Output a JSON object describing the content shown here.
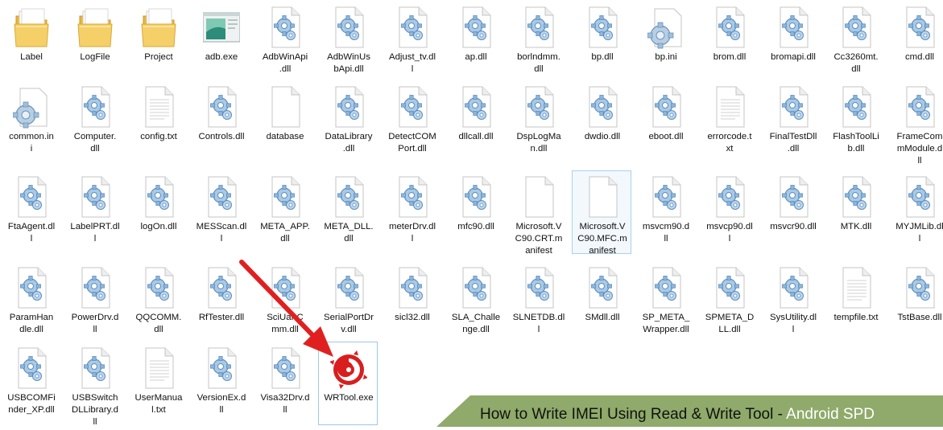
{
  "rows": [
    [
      {
        "label": "Label",
        "icon": "folder-icon"
      },
      {
        "label": "LogFile",
        "icon": "folder-icon"
      },
      {
        "label": "Project",
        "icon": "folder-icon"
      },
      {
        "label": "adb.exe",
        "icon": "application-window-icon"
      },
      {
        "label": "AdbWinApi\n.dll",
        "icon": "dll-gear-icon"
      },
      {
        "label": "AdbWinUs\nbApi.dll",
        "icon": "dll-gear-icon"
      },
      {
        "label": "Adjust_tv.dl\nl",
        "icon": "dll-gear-icon"
      },
      {
        "label": "ap.dll",
        "icon": "dll-gear-icon"
      },
      {
        "label": "borlndmm.\ndll",
        "icon": "dll-gear-icon"
      },
      {
        "label": "bp.dll",
        "icon": "dll-gear-icon"
      },
      {
        "label": "bp.ini",
        "icon": "settings-gear-icon"
      },
      {
        "label": "brom.dll",
        "icon": "dll-gear-icon"
      },
      {
        "label": "bromapi.dll",
        "icon": "dll-gear-icon"
      },
      {
        "label": "Cc3260mt.\ndll",
        "icon": "dll-gear-icon"
      },
      {
        "label": "cmd.dll",
        "icon": "dll-gear-icon"
      }
    ],
    [
      {
        "label": "common.in\ni",
        "icon": "settings-gear-icon"
      },
      {
        "label": "Computer.\ndll",
        "icon": "dll-gear-icon"
      },
      {
        "label": "config.txt",
        "icon": "text-file-icon"
      },
      {
        "label": "Controls.dll",
        "icon": "dll-gear-icon"
      },
      {
        "label": "database",
        "icon": "blank-file-icon"
      },
      {
        "label": "DataLibrary\n.dll",
        "icon": "dll-gear-icon"
      },
      {
        "label": "DetectCOM\nPort.dll",
        "icon": "dll-gear-icon"
      },
      {
        "label": "dllcall.dll",
        "icon": "dll-gear-icon"
      },
      {
        "label": "DspLogMa\nn.dll",
        "icon": "dll-gear-icon"
      },
      {
        "label": "dwdio.dll",
        "icon": "dll-gear-icon"
      },
      {
        "label": "eboot.dll",
        "icon": "dll-gear-icon"
      },
      {
        "label": "errorcode.t\nxt",
        "icon": "text-file-icon"
      },
      {
        "label": "FinalTestDll\n.dll",
        "icon": "dll-gear-icon"
      },
      {
        "label": "FlashToolLi\nb.dll",
        "icon": "dll-gear-icon"
      },
      {
        "label": "FrameCom\nmModule.d\nll",
        "icon": "dll-gear-icon"
      }
    ],
    [
      {
        "label": "FtaAgent.dl\nl",
        "icon": "dll-gear-icon"
      },
      {
        "label": "LabelPRT.dl\nl",
        "icon": "dll-gear-icon"
      },
      {
        "label": "logOn.dll",
        "icon": "dll-gear-icon"
      },
      {
        "label": "MESScan.dl\nl",
        "icon": "dll-gear-icon"
      },
      {
        "label": "META_APP.\ndll",
        "icon": "dll-gear-icon"
      },
      {
        "label": "META_DLL.\ndll",
        "icon": "dll-gear-icon"
      },
      {
        "label": "meterDrv.dl\nl",
        "icon": "dll-gear-icon"
      },
      {
        "label": "mfc90.dll",
        "icon": "dll-gear-icon"
      },
      {
        "label": "Microsoft.V\nC90.CRT.m\nanifest",
        "icon": "blank-file-icon"
      },
      {
        "label": "Microsoft.V\nC90.MFC.m\nanifest",
        "icon": "blank-file-icon"
      },
      {
        "label": "msvcm90.d\nll",
        "icon": "dll-gear-icon"
      },
      {
        "label": "msvcp90.dl\nl",
        "icon": "dll-gear-icon"
      },
      {
        "label": "msvcr90.dll",
        "icon": "dll-gear-icon"
      },
      {
        "label": "MTK.dll",
        "icon": "dll-gear-icon"
      },
      {
        "label": "MYJMLib.dl\nl",
        "icon": "dll-gear-icon"
      }
    ],
    [
      {
        "label": "ParamHan\ndle.dll",
        "icon": "dll-gear-icon"
      },
      {
        "label": "PowerDrv.d\nll",
        "icon": "dll-gear-icon"
      },
      {
        "label": "QQCOMM.\ndll",
        "icon": "dll-gear-icon"
      },
      {
        "label": "RfTester.dll",
        "icon": "dll-gear-icon"
      },
      {
        "label": "SciUartC\nmm.dll",
        "icon": "dll-gear-icon"
      },
      {
        "label": "SerialPortDr\nv.dll",
        "icon": "dll-gear-icon"
      },
      {
        "label": "sicl32.dll",
        "icon": "dll-gear-icon"
      },
      {
        "label": "SLA_Challe\nnge.dll",
        "icon": "dll-gear-icon"
      },
      {
        "label": "SLNETDB.dl\nl",
        "icon": "dll-gear-icon"
      },
      {
        "label": "SMdll.dll",
        "icon": "dll-gear-icon"
      },
      {
        "label": "SP_META_\nWrapper.dll",
        "icon": "dll-gear-icon"
      },
      {
        "label": "SPMETA_D\nLL.dll",
        "icon": "dll-gear-icon"
      },
      {
        "label": "SysUtility.dl\nl",
        "icon": "dll-gear-icon"
      },
      {
        "label": "tempfile.txt",
        "icon": "text-file-icon"
      },
      {
        "label": "TstBase.dll",
        "icon": "dll-gear-icon"
      }
    ],
    [
      {
        "label": "USBCOMFi\nnder_XP.dll",
        "icon": "dll-gear-icon"
      },
      {
        "label": "USBSwitch\nDLLibrary.d\nll",
        "icon": "dll-gear-icon"
      },
      {
        "label": "UserManua\nl.txt",
        "icon": "text-file-icon"
      },
      {
        "label": "VersionEx.d\nll",
        "icon": "dll-gear-icon"
      },
      {
        "label": "Visa32Drv.d\nll",
        "icon": "dll-gear-icon"
      },
      {
        "label": "WRTool.exe",
        "icon": "wrtool-swirl-icon"
      }
    ]
  ],
  "selected_item": "Microsoft.V\nC90.MFC.m\nanifest",
  "pointed_item": "WRTool.exe",
  "banner": {
    "main": "How to Write IMEI Using Read & Write Tool",
    "separator": " - ",
    "accent": "Android SPD"
  },
  "colors": {
    "banner_green": "#8faa6a",
    "arrow_red": "#e02020",
    "folder_yellow": "#f0c64e",
    "gear_blue": "#6fa3cf",
    "selection_border": "#a8d1ec"
  }
}
